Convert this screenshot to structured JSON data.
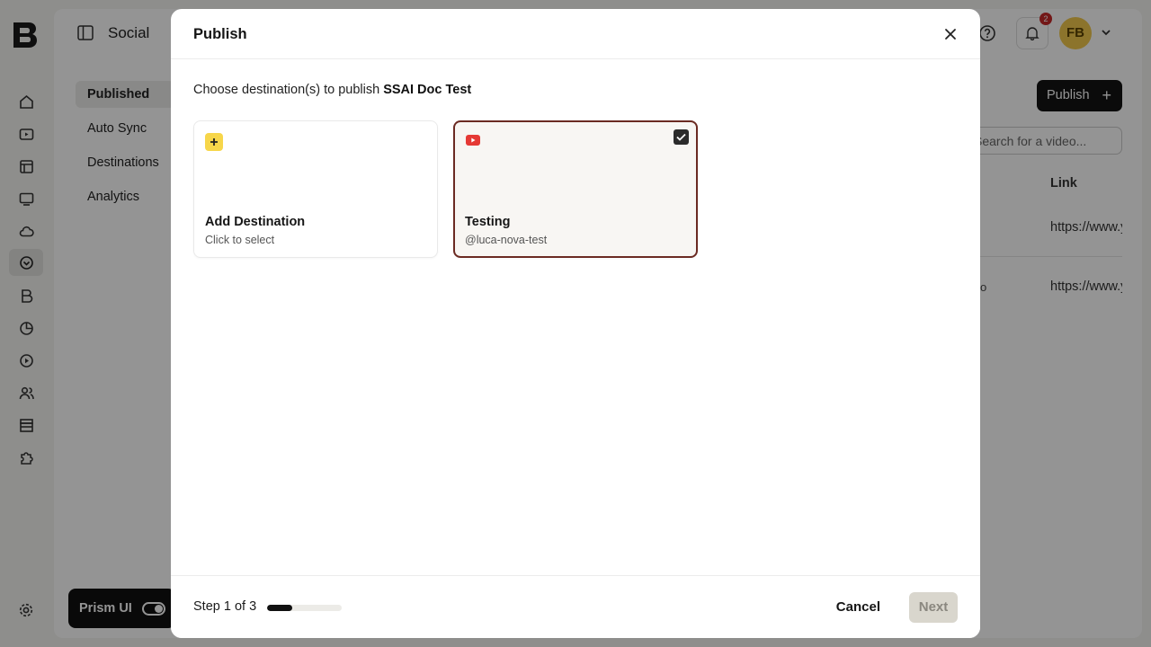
{
  "app": {
    "section_title": "Social",
    "subnav": [
      "Published",
      "Auto Sync",
      "Destinations",
      "Analytics"
    ],
    "notification_count": "2",
    "avatar_initials": "FB",
    "publish_button": "Publish",
    "search_placeholder": "Search for a video...",
    "table_link_header": "Link",
    "table_links": [
      "https://www.youtube.com/",
      "https://www.youtube.com/"
    ],
    "row_fragment": "o",
    "prism_label": "Prism UI"
  },
  "modal": {
    "title": "Publish",
    "prompt_prefix": "Choose destination(s) to publish",
    "prompt_item": "SSAI Doc Test",
    "cards": [
      {
        "title": "Add Destination",
        "subtitle": "Click to select",
        "icon": "plus-icon"
      },
      {
        "title": "Testing",
        "subtitle": "@luca-nova-test",
        "icon": "youtube-icon",
        "selected": true
      }
    ],
    "step_text": "Step 1 of 3",
    "progress": 0.333,
    "cancel_label": "Cancel",
    "next_label": "Next"
  },
  "colors": {
    "accent_dark": "#111111",
    "selected_border": "#6b2a22",
    "plus_badge": "#f7d64a",
    "youtube_red": "#e53935",
    "avatar_bg": "#f2c94c"
  }
}
